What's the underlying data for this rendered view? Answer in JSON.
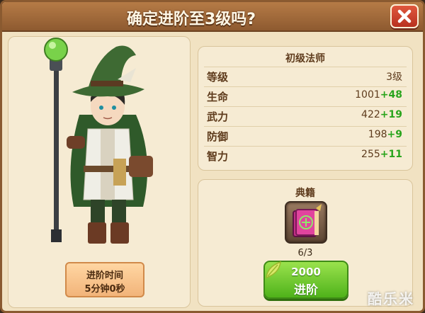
{
  "dialog": {
    "title": "确定进阶至3级吗?"
  },
  "hero": {
    "class_name": "初级法师",
    "advance_time_label": "进阶时间",
    "advance_time_value": "5分钟0秒"
  },
  "stats": [
    {
      "label": "等级",
      "value": "3级",
      "bonus": ""
    },
    {
      "label": "生命",
      "value": "1001",
      "bonus": "+48"
    },
    {
      "label": "武力",
      "value": "422",
      "bonus": "+19"
    },
    {
      "label": "防御",
      "value": "198",
      "bonus": "+9"
    },
    {
      "label": "智力",
      "value": "255",
      "bonus": "+11"
    }
  ],
  "requirement": {
    "section_title": "典籍",
    "item_icon": "spellbook-icon",
    "count": "6/3"
  },
  "advance_button": {
    "cost": "2000",
    "label": "进阶",
    "icon": "leaf-icon"
  },
  "watermark": "酷乐米",
  "colors": {
    "title_bar": "#a06a3a",
    "panel_bg": "#f6ebd3",
    "bonus_green": "#29a41c",
    "button_green": "#6cc72c",
    "close_red": "#cf4430"
  }
}
